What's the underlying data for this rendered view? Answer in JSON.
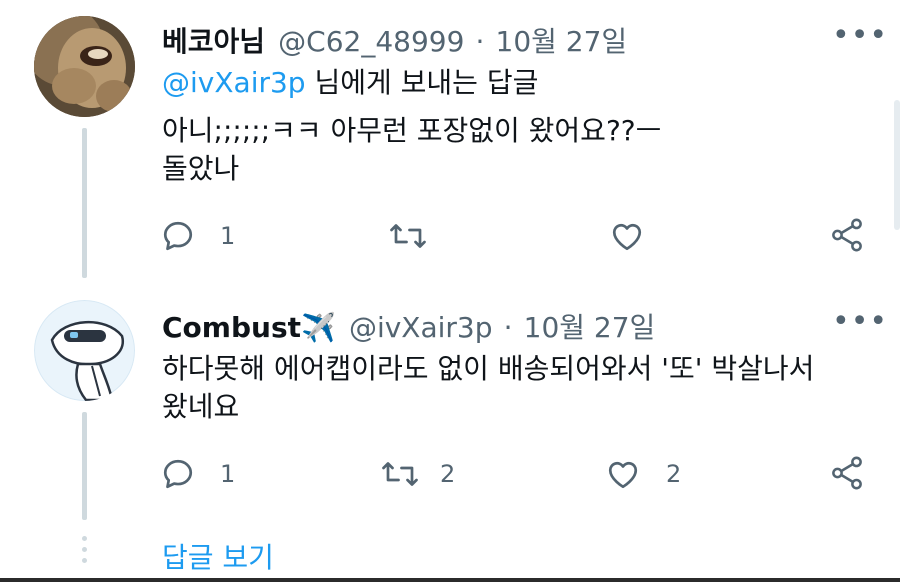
{
  "tweets": [
    {
      "display_name": "베코아님",
      "handle": "@C62_48999",
      "separator": "·",
      "date": "10월 27일",
      "replying_to": {
        "mention": "@ivXair3p",
        "suffix": " 님에게 보내는 답글"
      },
      "text_lines": [
        "아니;;;;;;ㅋㅋ 아무런 포장없이 왔어요??ㅡ",
        "돌았나"
      ],
      "reply_count": "1",
      "retweet_count": "",
      "like_count": ""
    },
    {
      "display_name": "Combust✈️",
      "handle": "@ivXair3p",
      "separator": "·",
      "date": "10월 27일",
      "text_lines": [
        "하다못해 에어캡이라도 없이 배송되어와서 '또' 박살나서",
        "왔네요"
      ],
      "reply_count": "1",
      "retweet_count": "2",
      "like_count": "2"
    }
  ],
  "show_replies_label": "답글 보기",
  "colors": {
    "accent": "#1d9bf0",
    "secondary_text": "#536471",
    "thread_line": "#cfd9de"
  },
  "icons": [
    "reply-icon",
    "retweet-icon",
    "like-icon",
    "share-icon",
    "more-icon"
  ]
}
